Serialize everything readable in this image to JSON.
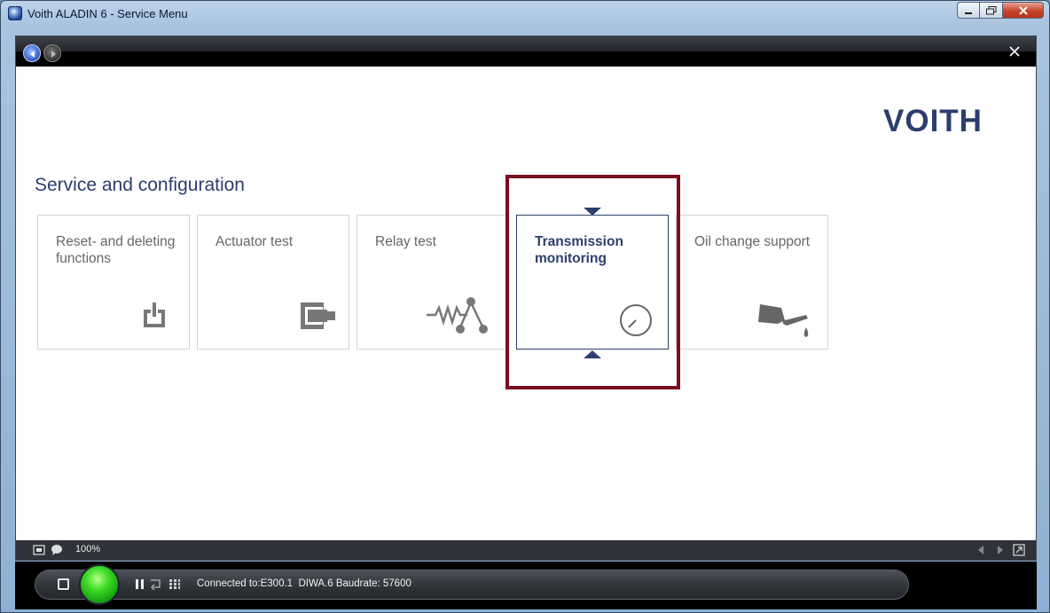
{
  "window": {
    "title": "Voith ALADIN 6 - Service Menu",
    "controls": [
      "minimize",
      "maximize",
      "close"
    ]
  },
  "toolbar": {
    "back_icon": "arrow-left-icon",
    "forward_icon": "arrow-right-icon",
    "close_icon": "close-icon"
  },
  "brand": {
    "logo": "VOITH"
  },
  "section": {
    "title": "Service and configuration"
  },
  "tiles": [
    {
      "label": "Reset- and deleting functions",
      "icon": "power-reset-icon",
      "selected": false
    },
    {
      "label": "Actuator test",
      "icon": "actuator-icon",
      "selected": false
    },
    {
      "label": "Relay test",
      "icon": "relay-icon",
      "selected": false
    },
    {
      "label": "Transmission monitoring",
      "icon": "gauge-icon",
      "selected": true
    },
    {
      "label": "Oil change support",
      "icon": "oil-can-icon",
      "selected": false
    }
  ],
  "statusbar": {
    "zoom": "100%",
    "icons": [
      "fit-screen-icon",
      "comment-icon",
      "scroll-left-icon",
      "scroll-right-icon",
      "expand-icon"
    ]
  },
  "connection": {
    "status_text": "Connected to:E300.1  DIWA.6 Baudrate: 57600",
    "buttons": [
      "stop",
      "go",
      "pause",
      "loop",
      "grid"
    ]
  },
  "colors": {
    "brand_blue": "#2c3e6e",
    "highlight_red": "#7a0e1e",
    "go_green": "#3fdc27"
  }
}
